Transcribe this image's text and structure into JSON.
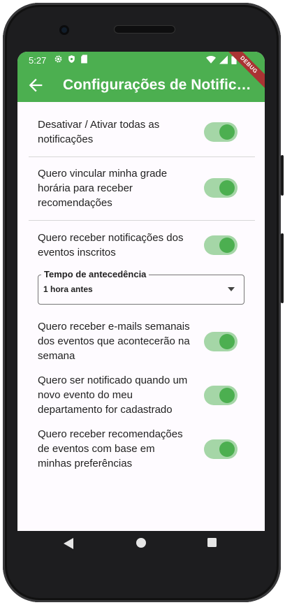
{
  "status_bar": {
    "time": "5:27"
  },
  "app_bar": {
    "title": "Configurações de Notificações",
    "debug_label": "DEBUG"
  },
  "settings": [
    {
      "label": "Desativar / Ativar todas as notificações",
      "enabled": true
    },
    {
      "label": "Quero vincular minha grade horária para receber recomendações",
      "enabled": true
    },
    {
      "label": "Quero receber notificações dos eventos inscritos",
      "enabled": true
    },
    {
      "label": "Quero receber e-mails semanais dos eventos que acontecerão na semana",
      "enabled": true
    },
    {
      "label": "Quero ser notificado quando um novo evento do meu departamento for cadastrado",
      "enabled": true
    },
    {
      "label": "Quero receber recomendações de eventos com base em minhas preferências",
      "enabled": true
    }
  ],
  "advance_dropdown": {
    "label": "Tempo de antecedência",
    "value": "1 hora antes"
  },
  "colors": {
    "primary": "#4caf50",
    "switch_track": "#a5d6a7",
    "background": "#fefbff"
  }
}
